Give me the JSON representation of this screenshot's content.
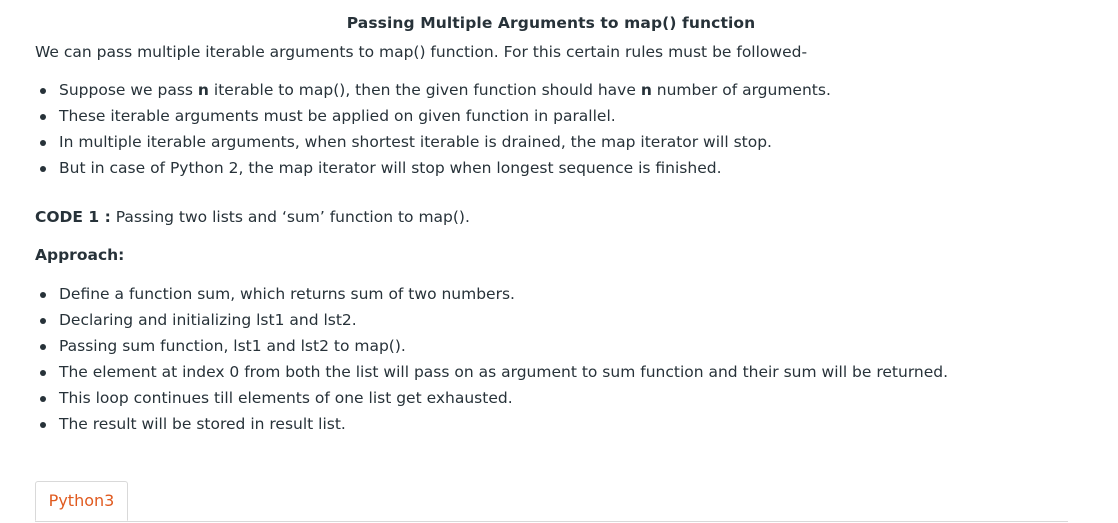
{
  "article": {
    "title": "Passing Multiple Arguments to map() function",
    "intro": "We can pass multiple iterable arguments to map() function. For this certain rules must be followed-",
    "rules": [
      {
        "before": "Suppose we pass ",
        "bold": "n",
        "middle": " iterable to map(), then the given function should have ",
        "bold2": "n",
        "after": " number of arguments."
      },
      {
        "text": "These iterable arguments must be applied on given function in parallel."
      },
      {
        "text": "In multiple iterable arguments, when shortest iterable is drained, the map iterator will stop."
      },
      {
        "text": "But in case of Python 2, the map iterator will stop when longest sequence is finished."
      }
    ],
    "code1": {
      "label": "CODE 1 :",
      "text": " Passing two lists and ‘sum’ function to map()."
    },
    "approach_heading": "Approach:",
    "approach": [
      "Define a function sum, which returns sum of two numbers.",
      "Declaring and initializing lst1 and lst2.",
      "Passing sum function, lst1 and lst2 to map().",
      "The element at index 0 from both the list will pass on as argument to sum function and their sum will be returned.",
      "This loop continues till elements of one list get exhausted.",
      "The result will be stored in result list."
    ]
  },
  "tabs": [
    {
      "label": "Python3",
      "active": true
    }
  ],
  "colors": {
    "text": "#273239",
    "tab_accent": "#e05a1f",
    "border": "#d9d9d9"
  }
}
